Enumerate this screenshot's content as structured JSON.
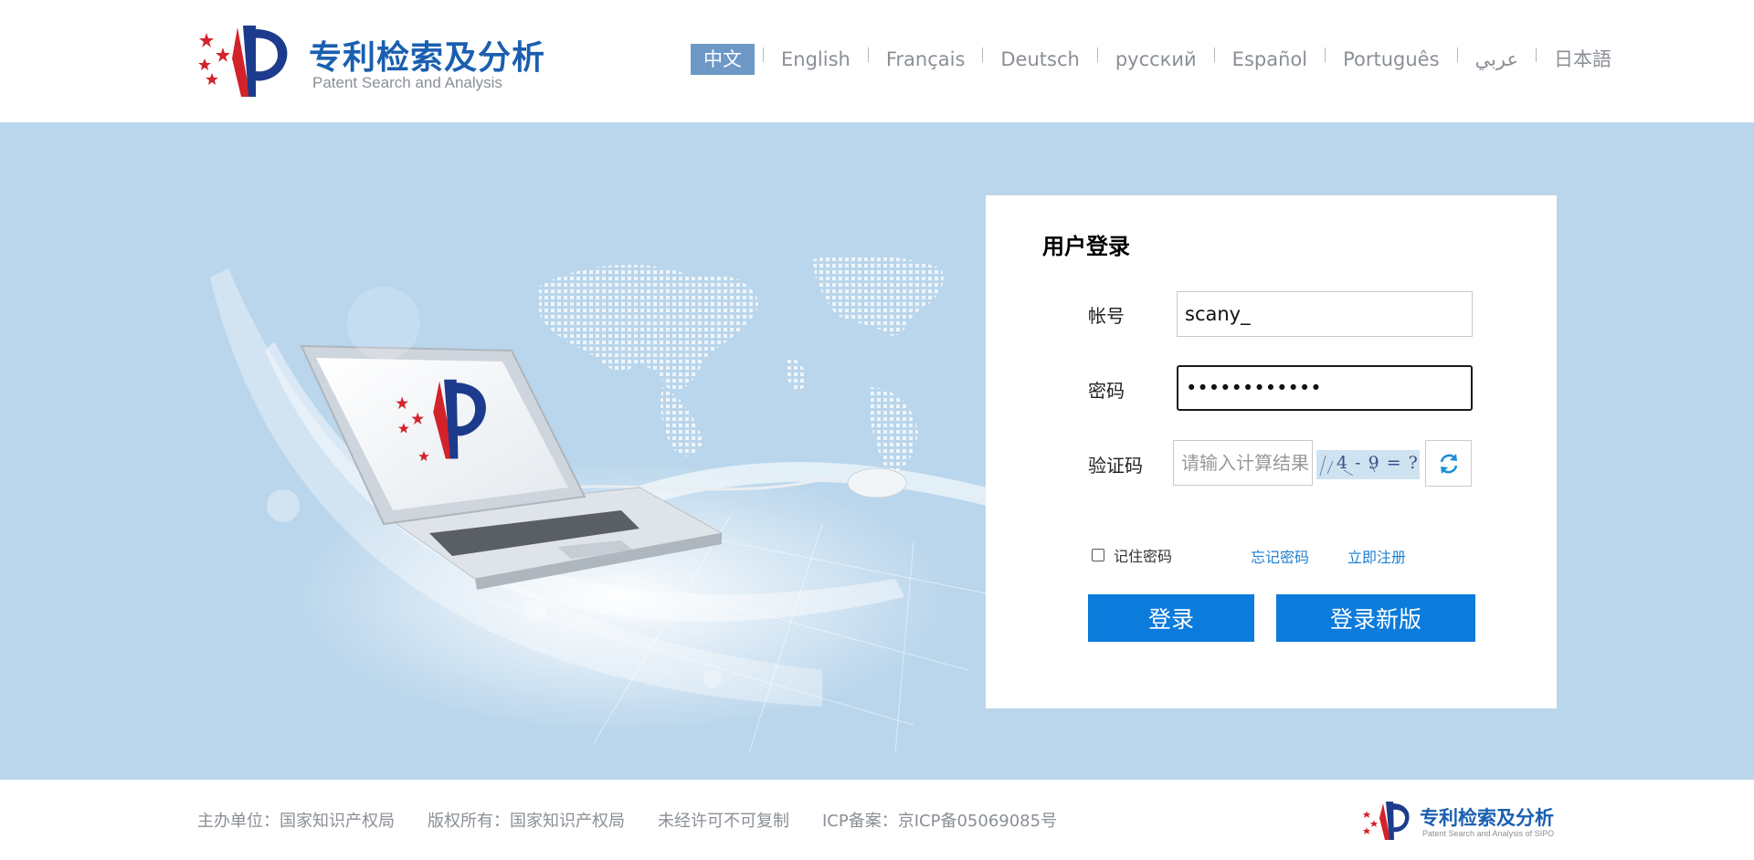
{
  "header": {
    "logo_title": "专利检索及分析",
    "logo_subtitle": "Patent Search and Analysis",
    "languages": [
      "中文",
      "English",
      "Français",
      "Deutsch",
      "русский",
      "Español",
      "Português",
      "عربي",
      "日本語"
    ],
    "active_language": "中文"
  },
  "login": {
    "title": "用户登录",
    "account_label": "帐号",
    "account_value": "scany_",
    "password_label": "密码",
    "password_value": "••••••••••••",
    "captcha_label": "验证码",
    "captcha_placeholder": "请输入计算结果",
    "captcha_text": "4 - 9 = ?",
    "remember_label": "记住密码",
    "forgot_link": "忘记密码",
    "register_link": "立即注册",
    "login_button": "登录",
    "login_new_button": "登录新版"
  },
  "footer": {
    "items": [
      "主办单位：国家知识产权局",
      "版权所有：国家知识产权局",
      "未经许可不可复制",
      "ICP备案：京ICP备05069085号"
    ],
    "logo_title": "专利检索及分析",
    "logo_subtitle": "Patent Search and Analysis of SIPO"
  },
  "colors": {
    "brand_blue": "#1a5fb0",
    "banner_bg": "#bad6ec",
    "button_blue": "#0b7bdc",
    "link_blue": "#1e7fd0",
    "active_lang_bg": "#6e98c6",
    "logo_red": "#d3222a"
  }
}
